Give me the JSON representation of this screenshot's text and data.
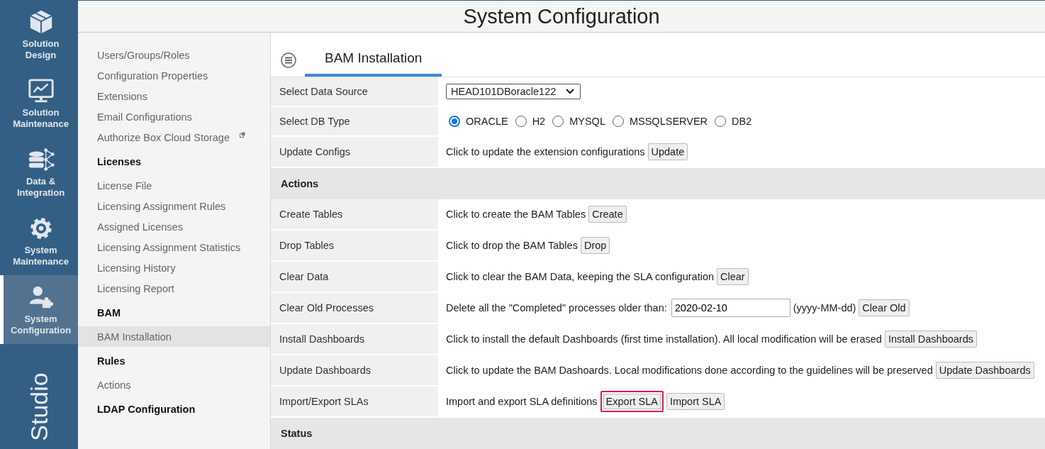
{
  "rail": {
    "items": [
      {
        "label": "Solution Design",
        "selected": false
      },
      {
        "label": "Solution Maintenance",
        "selected": false
      },
      {
        "label": "Data & Integration",
        "selected": false
      },
      {
        "label": "System Maintenance",
        "selected": false
      },
      {
        "label": "System Configuration",
        "selected": true
      }
    ],
    "brand": "Studio"
  },
  "header": {
    "title": "System Configuration"
  },
  "sidebar": {
    "items": [
      {
        "kind": "link",
        "label": "Users/Groups/Roles",
        "selected": false
      },
      {
        "kind": "link",
        "label": "Configuration Properties",
        "selected": false
      },
      {
        "kind": "link",
        "label": "Extensions",
        "selected": false
      },
      {
        "kind": "link",
        "label": "Email Configurations",
        "selected": false
      },
      {
        "kind": "external",
        "label": "Authorize Box Cloud Storage",
        "selected": false
      },
      {
        "kind": "heading",
        "label": "Licenses"
      },
      {
        "kind": "link",
        "label": "License File",
        "selected": false
      },
      {
        "kind": "link",
        "label": "Licensing Assignment Rules",
        "selected": false
      },
      {
        "kind": "link",
        "label": "Assigned Licenses",
        "selected": false
      },
      {
        "kind": "link",
        "label": "Licensing Assignment Statistics",
        "selected": false
      },
      {
        "kind": "link",
        "label": "Licensing History",
        "selected": false
      },
      {
        "kind": "link",
        "label": "Licensing Report",
        "selected": false
      },
      {
        "kind": "heading",
        "label": "BAM"
      },
      {
        "kind": "link",
        "label": "BAM Installation",
        "selected": true
      },
      {
        "kind": "heading",
        "label": "Rules"
      },
      {
        "kind": "link",
        "label": "Actions",
        "selected": false
      },
      {
        "kind": "heading",
        "label": "LDAP Configuration"
      }
    ]
  },
  "tabs": [
    {
      "label": "BAM Installation",
      "selected": true
    }
  ],
  "rows": [
    {
      "kind": "select",
      "label": "Select Data Source",
      "value": "HEAD101DBoracle122"
    },
    {
      "kind": "radios",
      "label": "Select DB Type",
      "options": [
        {
          "label": "ORACLE",
          "selected": true
        },
        {
          "label": "H2",
          "selected": false
        },
        {
          "label": "MYSQL",
          "selected": false
        },
        {
          "label": "MSSQLSERVER",
          "selected": false
        },
        {
          "label": "DB2",
          "selected": false
        }
      ]
    },
    {
      "kind": "action",
      "label": "Update Configs",
      "text": "Click to update the extension configurations",
      "buttons": [
        {
          "label": "Update",
          "highlighted": false
        }
      ]
    },
    {
      "kind": "section",
      "label": "Actions"
    },
    {
      "kind": "action",
      "label": "Create Tables",
      "text": "Click to create the BAM Tables",
      "buttons": [
        {
          "label": "Create",
          "highlighted": false
        }
      ]
    },
    {
      "kind": "action",
      "label": "Drop Tables",
      "text": "Click to drop the BAM Tables",
      "buttons": [
        {
          "label": "Drop",
          "highlighted": false
        }
      ]
    },
    {
      "kind": "action",
      "label": "Clear Data",
      "text": "Click to clear the BAM Data, keeping the SLA configuration",
      "buttons": [
        {
          "label": "Clear",
          "highlighted": false
        }
      ]
    },
    {
      "kind": "date",
      "label": "Clear Old Processes",
      "text": "Delete all the \"Completed\" processes older than:",
      "value": "2020-02-10",
      "hint": "(yyyy-MM-dd)",
      "buttons": [
        {
          "label": "Clear Old",
          "highlighted": false
        }
      ]
    },
    {
      "kind": "action",
      "label": "Install Dashboards",
      "text": "Click to install the default Dashboards (first time installation). All local modification will be erased",
      "buttons": [
        {
          "label": "Install Dashboards",
          "highlighted": false
        }
      ]
    },
    {
      "kind": "action",
      "label": "Update Dashboards",
      "text": "Click to update the BAM Dashoards. Local modifications done according to the guidelines will be preserved",
      "buttons": [
        {
          "label": "Update Dashboards",
          "highlighted": false
        }
      ]
    },
    {
      "kind": "action",
      "label": "Import/Export SLAs",
      "text": "Import and export SLA definitions",
      "buttons": [
        {
          "label": "Export SLA",
          "highlighted": true
        },
        {
          "label": "Import SLA",
          "highlighted": false
        }
      ]
    },
    {
      "kind": "section",
      "label": "Status"
    }
  ]
}
